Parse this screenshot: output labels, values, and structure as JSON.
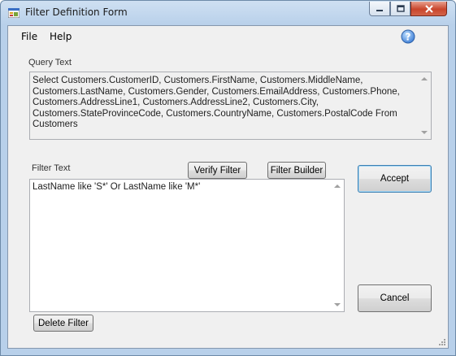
{
  "window": {
    "title": "Filter Definition Form"
  },
  "menu": {
    "file": "File",
    "help": "Help"
  },
  "query": {
    "label": "Query Text",
    "text": "Select Customers.CustomerID, Customers.FirstName, Customers.MiddleName, Customers.LastName, Customers.Gender, Customers.EmailAddress, Customers.Phone, Customers.AddressLine1, Customers.AddressLine2, Customers.City, Customers.StateProvinceCode, Customers.CountryName, Customers.PostalCode From Customers"
  },
  "filter": {
    "label": "Filter Text",
    "text": "LastName like 'S*'  Or LastName like 'M*'",
    "verify_label": "Verify Filter",
    "builder_label": "Filter Builder",
    "delete_label": "Delete Filter"
  },
  "actions": {
    "accept_label": "Accept",
    "cancel_label": "Cancel"
  },
  "colors": {
    "accent": "#3c7fb1",
    "help_icon": "#3a7bd5",
    "close_button": "#c9462c"
  }
}
